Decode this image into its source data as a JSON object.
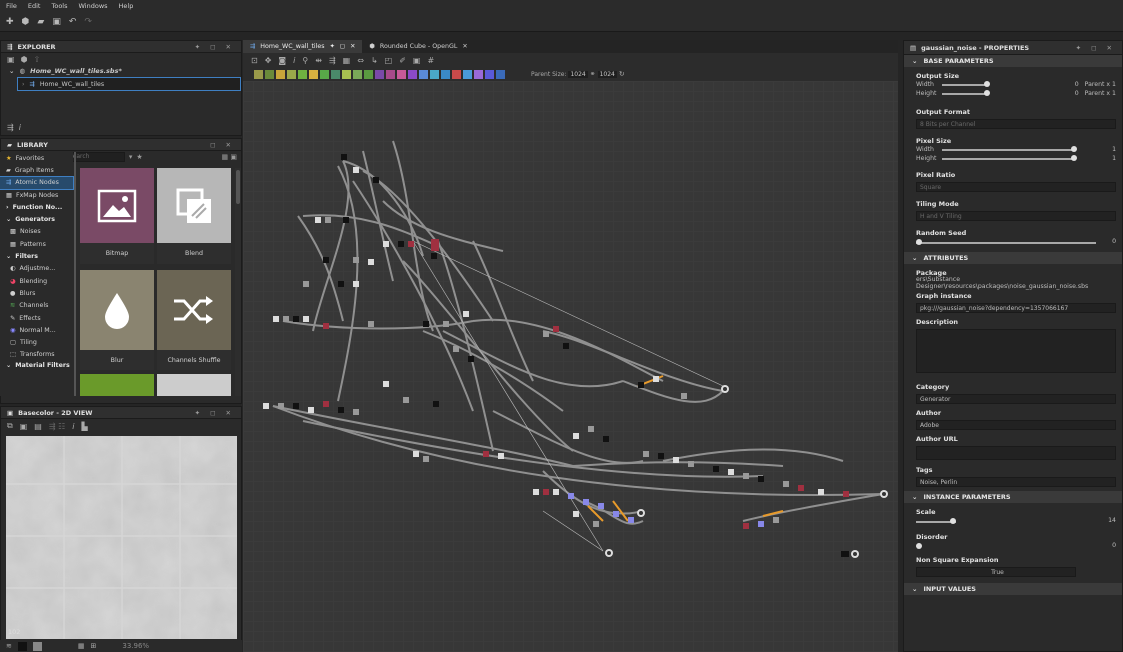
{
  "menu": [
    "File",
    "Edit",
    "Tools",
    "Windows",
    "Help"
  ],
  "explorer": {
    "title": "EXPLORER",
    "package": "Home_WC_wall_tiles.sbs*",
    "graph": "Home_WC_wall_tiles"
  },
  "library": {
    "title": "LIBRARY",
    "search_placeholder": "Search",
    "items": [
      {
        "label": "Favorites",
        "icon": "star-icon"
      },
      {
        "label": "Graph Items",
        "icon": "folder-icon"
      },
      {
        "label": "Atomic Nodes",
        "icon": "atomic-icon"
      },
      {
        "label": "FxMap Nodes",
        "icon": "fxmap-icon"
      },
      {
        "label": "Function No...",
        "icon": "function-icon"
      },
      {
        "label": "Generators",
        "icon": "chevron-down-icon"
      },
      {
        "label": "Noises",
        "icon": "noise-icon"
      },
      {
        "label": "Patterns",
        "icon": "pattern-icon"
      },
      {
        "label": "Filters",
        "icon": "chevron-down-icon"
      },
      {
        "label": "Adjustme...",
        "icon": "adjust-icon"
      },
      {
        "label": "Blending",
        "icon": "blend-icon"
      },
      {
        "label": "Blurs",
        "icon": "blur-icon"
      },
      {
        "label": "Channels",
        "icon": "channels-icon"
      },
      {
        "label": "Effects",
        "icon": "effects-icon"
      },
      {
        "label": "Normal M...",
        "icon": "normal-icon"
      },
      {
        "label": "Tiling",
        "icon": "tiling-icon"
      },
      {
        "label": "Transforms",
        "icon": "transform-icon"
      },
      {
        "label": "Material Filters",
        "icon": "chevron-down-icon"
      }
    ],
    "tiles": [
      "Bitmap",
      "Blend",
      "Blur",
      "Channels Shuffle"
    ]
  },
  "view2d": {
    "title": "Basecolor - 2D VIEW",
    "corner": "102",
    "zoom": "33.96%"
  },
  "tabs": [
    {
      "label": "Home_WC_wall_tiles"
    },
    {
      "label": "Rounded Cube - OpenGL"
    }
  ],
  "graph_toolbar": {
    "parent_size_label": "Parent Size:",
    "parent_size": "1024",
    "size2": "1024"
  },
  "colors": {
    "accent": "#3f7fc2",
    "bitmap_tile": "#7a4a66",
    "blur_tile": "#8a8470",
    "green_tile": "#6a9a2a"
  },
  "props": {
    "title": "gaussian_noise - PROPERTIES",
    "base_section": "BASE PARAMETERS",
    "output_size": "Output Size",
    "width": "Width",
    "height": "Height",
    "zero": "0",
    "parent_x1": "Parent x 1",
    "output_format": "Output Format",
    "format_value": "8 Bits per Channel",
    "pixel_size": "Pixel Size",
    "one": "1",
    "pixel_ratio": "Pixel Ratio",
    "ratio_value": "Square",
    "tiling_mode": "Tiling Mode",
    "tiling_value": "H and V Tiling",
    "random_seed": "Random Seed",
    "attr_section": "ATTRIBUTES",
    "package": "Package",
    "package_value": "ers\\Substance Designer\\resources\\packages\\noise_gaussian_noise.sbs",
    "graph_instance": "Graph instance",
    "graph_instance_value": "pkg:///gaussian_noise?dependency=1357066167",
    "description": "Description",
    "category": "Category",
    "category_value": "Generator",
    "author": "Author",
    "author_value": "Adobe",
    "author_url": "Author URL",
    "tags": "Tags",
    "tags_value": "Noise, Perlin",
    "inst_section": "INSTANCE PARAMETERS",
    "scale": "Scale",
    "scale_value": "14",
    "disorder": "Disorder",
    "nse": "Non Square Expansion",
    "nse_value": "True",
    "input_section": "INPUT VALUES"
  }
}
